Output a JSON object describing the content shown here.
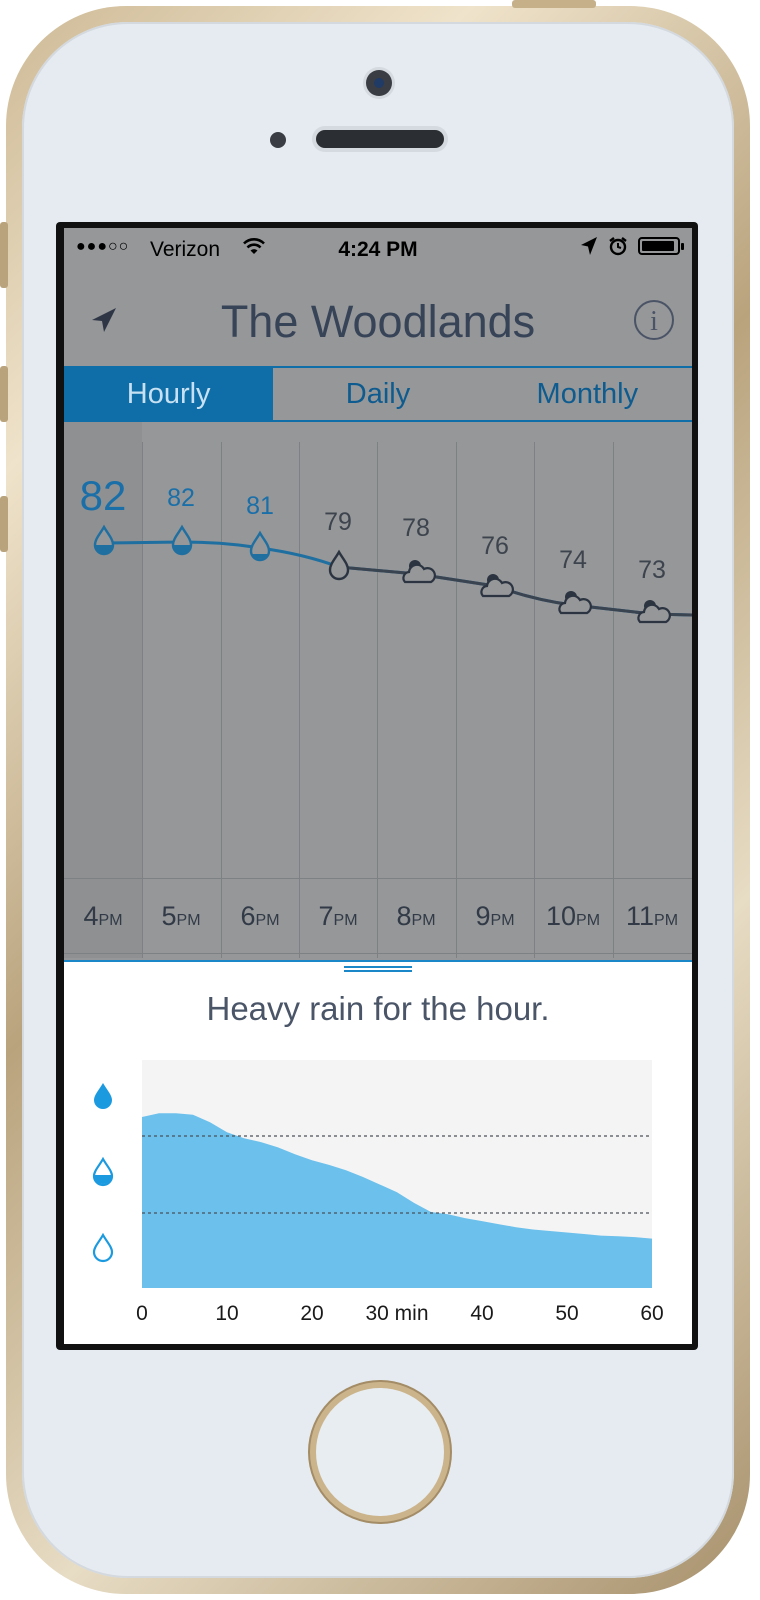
{
  "status_bar": {
    "signal": "●●●○○",
    "carrier": "Verizon",
    "time": "4:24 PM"
  },
  "header": {
    "title": "The Woodlands",
    "info_label": "i"
  },
  "tabs": [
    {
      "label": "Hourly",
      "active": true
    },
    {
      "label": "Daily",
      "active": false
    },
    {
      "label": "Monthly",
      "active": false
    }
  ],
  "hourly": [
    {
      "temp": "82",
      "hour": "4",
      "ampm": "PM",
      "icon": "rain-drop-heavy-icon"
    },
    {
      "temp": "82",
      "hour": "5",
      "ampm": "PM",
      "icon": "rain-drop-heavy-icon"
    },
    {
      "temp": "81",
      "hour": "6",
      "ampm": "PM",
      "icon": "rain-drop-light-icon"
    },
    {
      "temp": "79",
      "hour": "7",
      "ampm": "PM",
      "icon": "rain-drop-outline-icon"
    },
    {
      "temp": "78",
      "hour": "8",
      "ampm": "PM",
      "icon": "partly-cloudy-icon"
    },
    {
      "temp": "76",
      "hour": "9",
      "ampm": "PM",
      "icon": "partly-cloudy-icon"
    },
    {
      "temp": "74",
      "hour": "10",
      "ampm": "PM",
      "icon": "partly-cloudy-icon"
    },
    {
      "temp": "73",
      "hour": "11",
      "ampm": "PM",
      "icon": "partly-cloudy-icon"
    }
  ],
  "colors": {
    "accent": "#0f6ea8",
    "rain_fill": "#6cc0ec",
    "current_temp": "#1a6fa8"
  },
  "summary": "Heavy rain for the hour.",
  "chart_data": {
    "type": "area",
    "xlabel": "",
    "x_ticks": [
      "0",
      "10",
      "20",
      "30 min",
      "40",
      "50",
      "60"
    ],
    "y_levels": [
      "light",
      "moderate",
      "heavy"
    ],
    "ylim": [
      0,
      3
    ],
    "x": [
      0,
      2,
      4,
      6,
      8,
      10,
      12,
      14,
      16,
      18,
      20,
      22,
      24,
      26,
      28,
      30,
      32,
      34,
      36,
      38,
      40,
      42,
      44,
      46,
      48,
      50,
      52,
      54,
      56,
      58,
      60
    ],
    "values": [
      2.25,
      2.3,
      2.3,
      2.28,
      2.18,
      2.05,
      1.97,
      1.92,
      1.85,
      1.76,
      1.68,
      1.62,
      1.55,
      1.46,
      1.36,
      1.26,
      1.12,
      1.0,
      0.97,
      0.92,
      0.88,
      0.84,
      0.8,
      0.77,
      0.75,
      0.73,
      0.71,
      0.69,
      0.68,
      0.67,
      0.65
    ]
  }
}
